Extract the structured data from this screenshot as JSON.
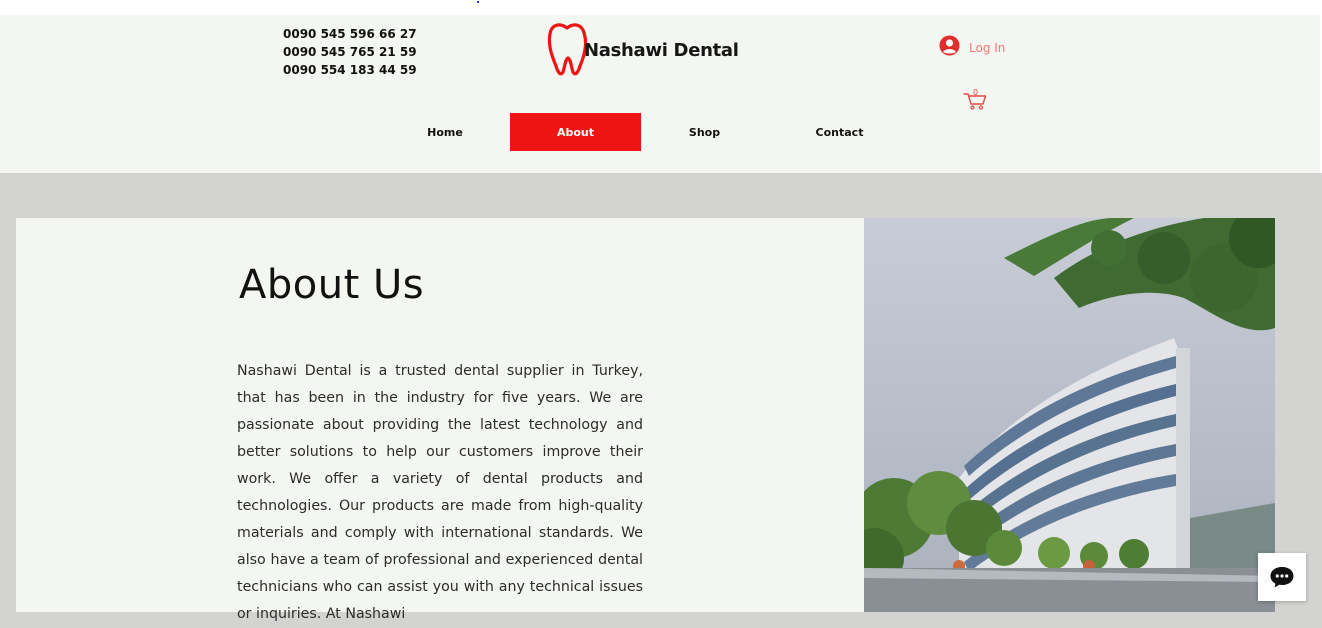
{
  "header": {
    "phones": [
      "0090 545 596 66 27",
      "0090 545 765 21 59",
      "0090 554 183 44 59"
    ],
    "brand": "Nashawi Dental",
    "login_label": "Log In",
    "cart_count": "0",
    "colors": {
      "accent_red": "#ef1414",
      "header_bg": "#f3f6f1",
      "login_text": "#f07b77"
    },
    "icons": {
      "logo": "tooth-logo-icon",
      "login": "user-avatar-icon",
      "cart": "shopping-cart-icon"
    }
  },
  "nav": {
    "items": [
      {
        "label": "Home",
        "active": false
      },
      {
        "label": "About",
        "active": true
      },
      {
        "label": "Shop",
        "active": false
      },
      {
        "label": "Contact",
        "active": false
      }
    ]
  },
  "about": {
    "title": "About Us",
    "body": "Nashawi Dental is a trusted dental supplier in Turkey, that has been in the industry for five years. We are passionate about providing the latest technology and better solutions to help our customers improve their work. We offer a variety of dental products and technologies. Our products are made from high-quality materials and comply with international standards. We also have a team of professional and experienced dental technicians who can assist you with any technical issues or inquiries. At Nashawi"
  },
  "chat": {
    "icon": "chat-bubble-icon"
  }
}
